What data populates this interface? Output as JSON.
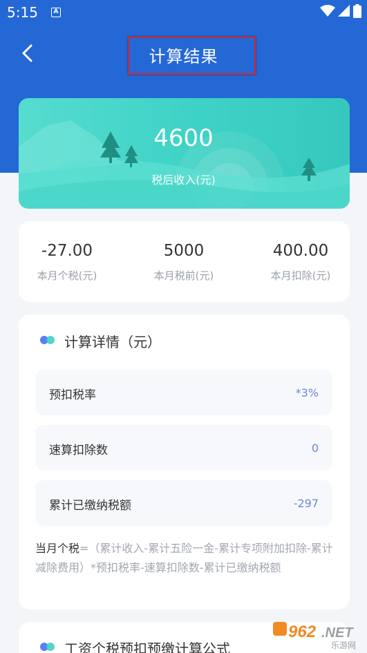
{
  "status_bar": {
    "time": "5:15",
    "notif_letter": "A"
  },
  "header": {
    "title": "计算结果"
  },
  "hero": {
    "value": "4600",
    "label": "税后收入(元)"
  },
  "summary": [
    {
      "value": "-27.00",
      "label": "本月个税(元)"
    },
    {
      "value": "5000",
      "label": "本月税前(元)"
    },
    {
      "value": "400.00",
      "label": "本月扣除(元)"
    }
  ],
  "details": {
    "title": "计算详情（元）",
    "rows": [
      {
        "label": "预扣税率",
        "value": "*3%"
      },
      {
        "label": "速算扣除数",
        "value": "0"
      },
      {
        "label": "累计已缴纳税额",
        "value": "-297"
      }
    ],
    "note_head": "当月个税",
    "note_body": "=（累计收入-累计五险一金-累计专项附加扣除-累计减除费用）*预扣税率-速算扣除数-累计已缴纳税额"
  },
  "formula": {
    "title": "工资个税预扣预缴计算公式"
  },
  "watermark": {
    "text": "962.NET",
    "sub": "乐游网"
  },
  "colors": {
    "header_blue": "#2468d6",
    "teal": "#3fd3c6",
    "value_blue": "#6b88d8",
    "highlight_red": "#d8232a"
  }
}
